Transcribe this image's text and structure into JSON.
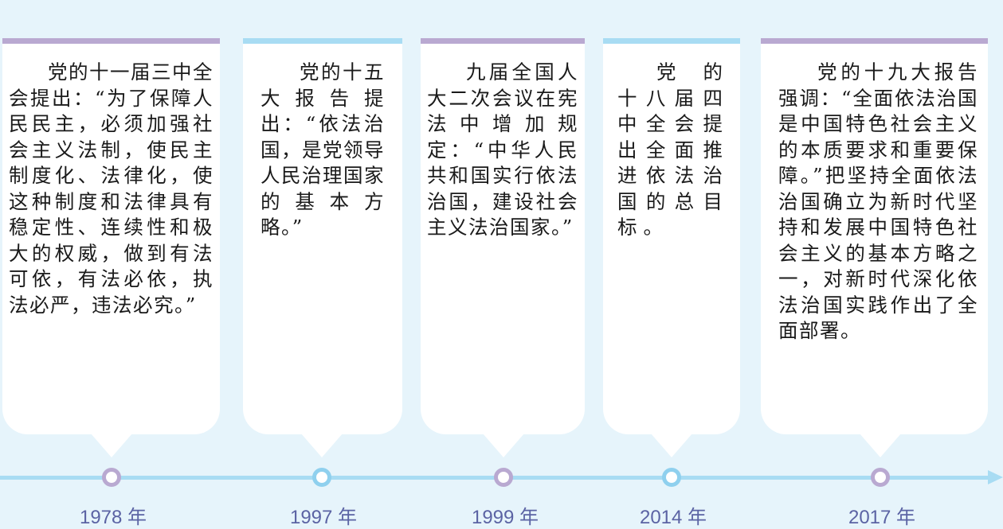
{
  "events": [
    {
      "text": "党的十一届三中全会提出：“为了保障人民民主，必须加强社会主义法制，使民主制度化、法律化，使这种制度和法律具有稳定性、连续性和极大的权威，做到有法可依，有法必依，执法必严，违法必究。”",
      "year": "1978 年",
      "accent": "#b9a9d1"
    },
    {
      "text": "党的十五大报告提出：“依法治国，是党领导人民治理国家的基本方略。”",
      "year": "1997 年",
      "accent": "#a8dcf3"
    },
    {
      "text": "九届全国人大二次会议在宪法中增加规定：“中华人民共和国实行依法治国，建设社会主义法治国家。”",
      "year": "1999 年",
      "accent": "#b9a9d1"
    },
    {
      "text": "党的十八届四中全会提出全面推进依法治国的总目标。",
      "year": "2014 年",
      "accent": "#a8dcf3"
    },
    {
      "text": "党的十九大报告强调：“全面依法治国是中国特色社会主义的本质要求和重要保障。”把坚持全面依法治国确立为新时代坚持和发展中国特色社会主义的基本方略之一，对新时代深化依法治国实践作出了全面部署。",
      "year": "2017 年",
      "accent": "#b9a9d1"
    }
  ]
}
